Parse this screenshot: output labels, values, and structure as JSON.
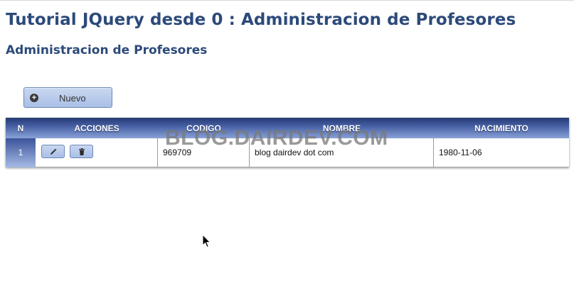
{
  "page": {
    "title": "Tutorial JQuery desde 0 : Administracion de Profesores",
    "subtitle": "Administracion de Profesores"
  },
  "toolbar": {
    "new_label": "Nuevo",
    "new_icon": "plus-circle-icon"
  },
  "table": {
    "columns": [
      "N",
      "ACCIONES",
      "CODIGO",
      "NOMBRE",
      "NACIMIENTO"
    ],
    "rows": [
      {
        "n": "1",
        "actions": [
          "edit-pencil-icon",
          "delete-trash-icon"
        ],
        "codigo": "969709",
        "nombre": "blog dairdev dot com",
        "nacimiento": "1980-11-06"
      }
    ]
  },
  "watermark": "BLOG.DAIRDEV.COM",
  "colors": {
    "title": "#2c4a7a",
    "header_dark": "#263a74",
    "header_light": "#8aa2d8",
    "button_bg": "#b8cbea"
  }
}
